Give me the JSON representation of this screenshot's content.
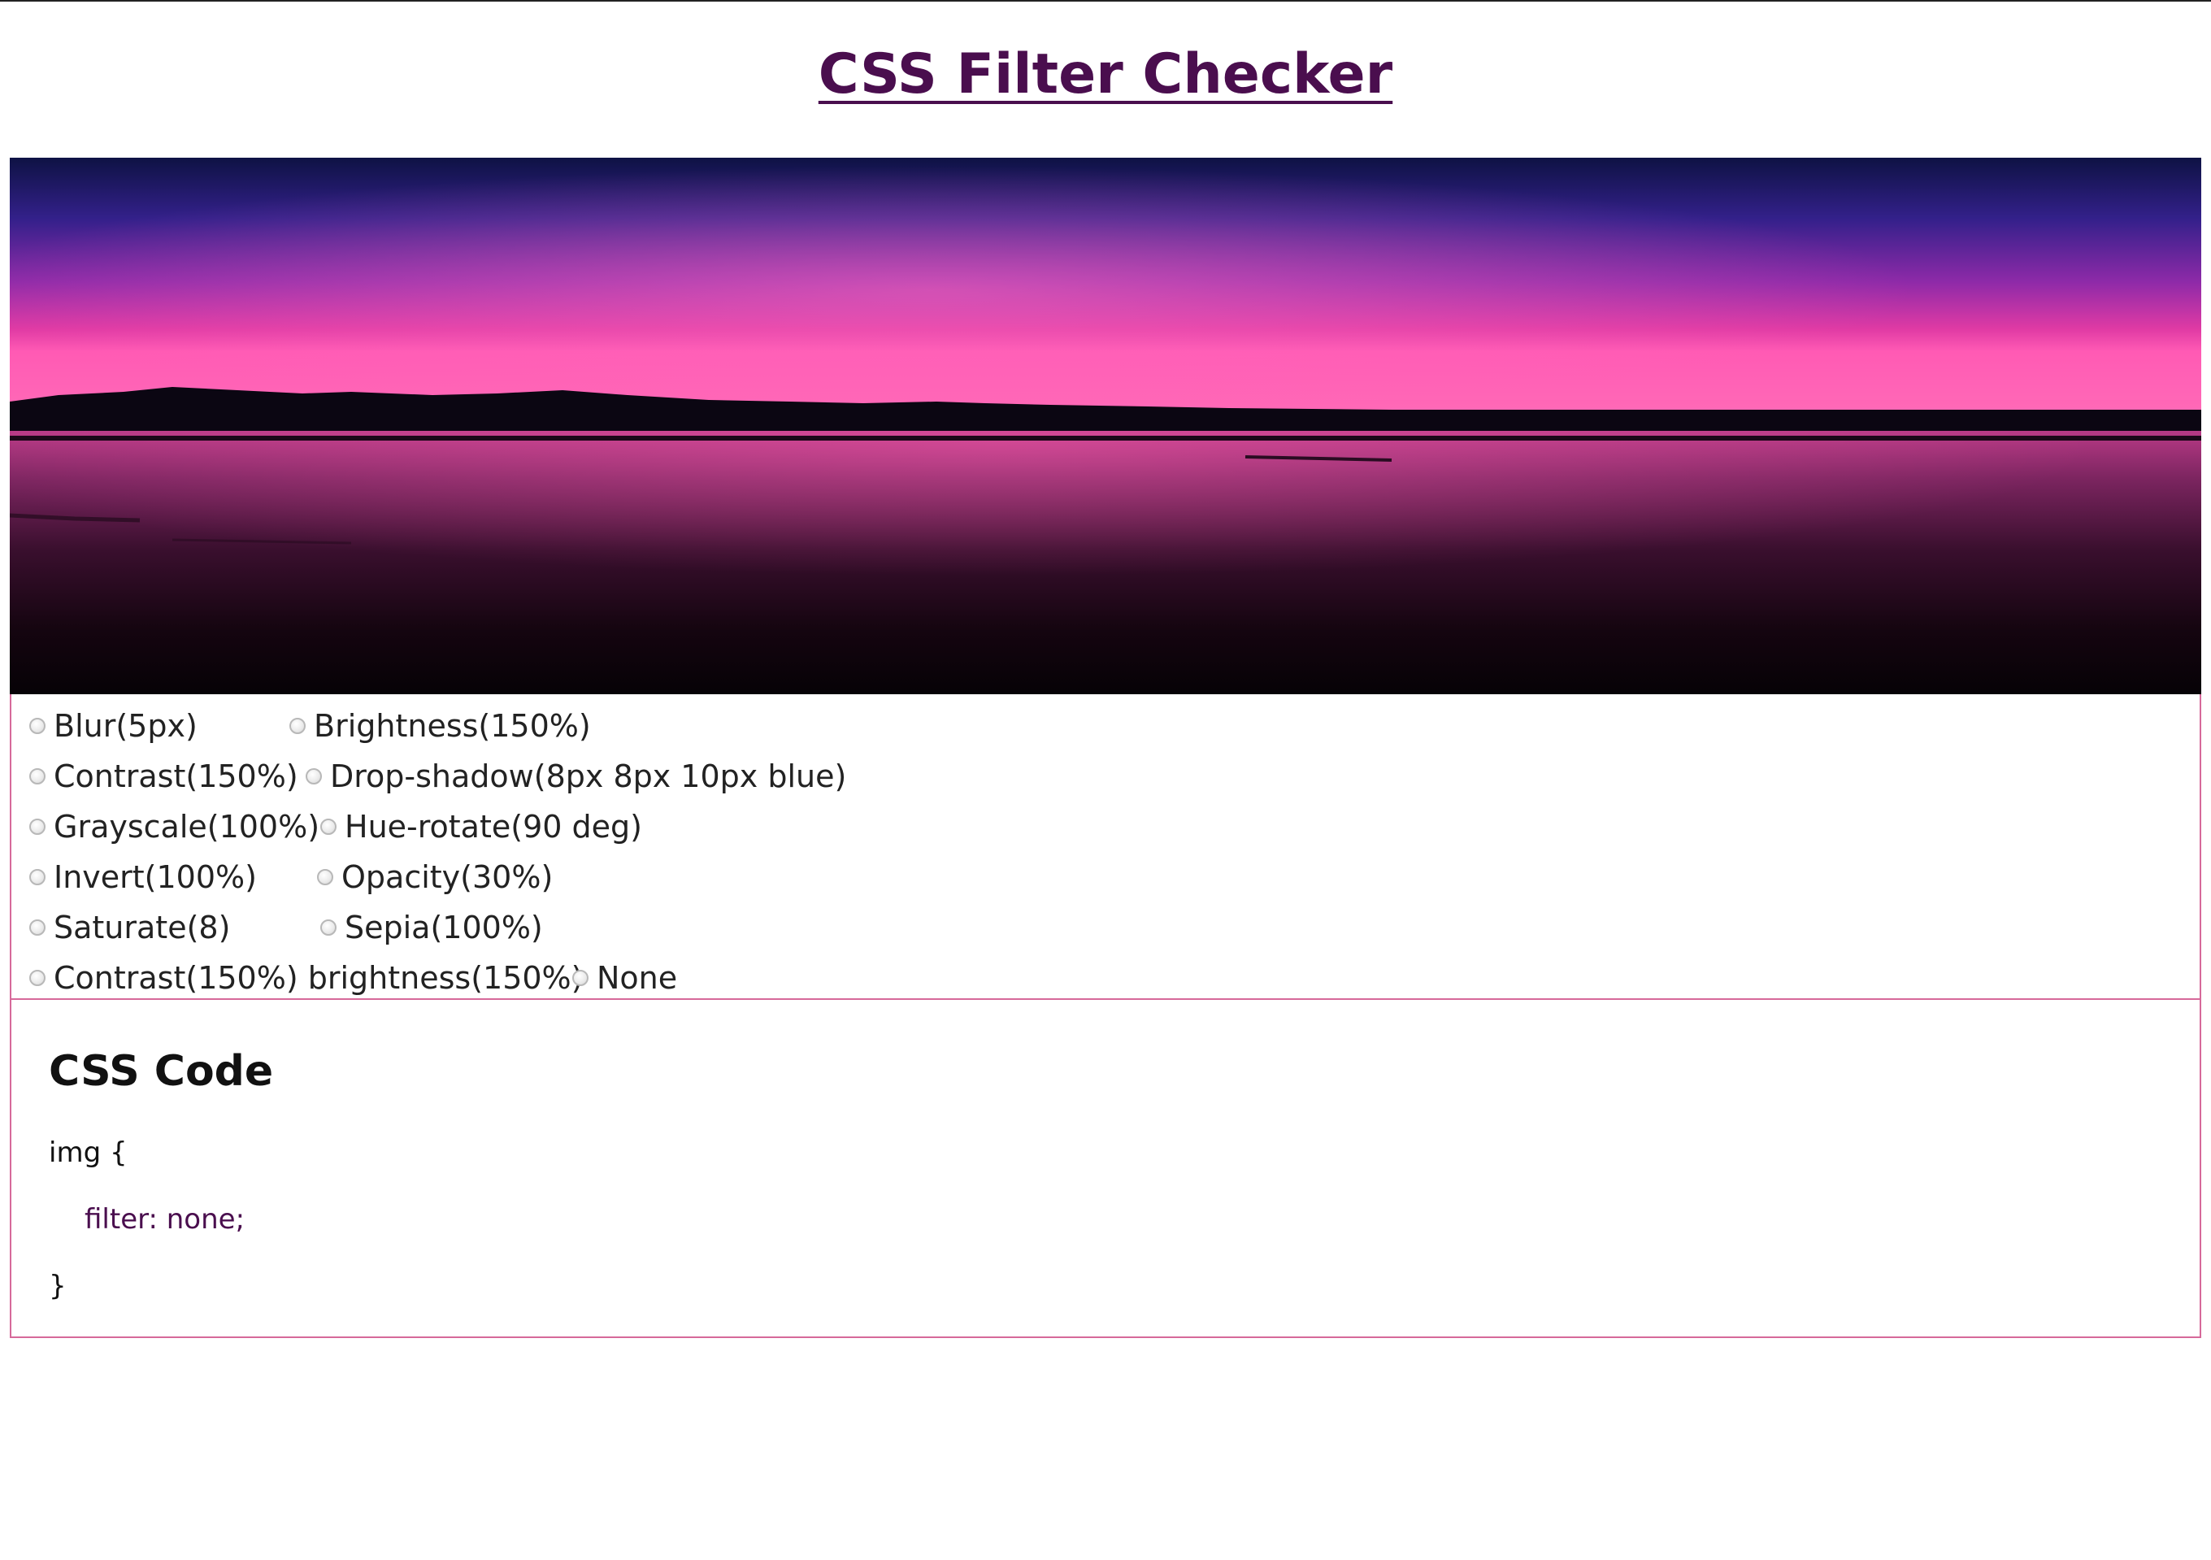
{
  "page": {
    "title": "CSS Filter Checker"
  },
  "colors": {
    "title": "#4a0e4e",
    "border": "#d6699a",
    "code_accent": "#4a0e4e"
  },
  "image": {
    "alt": "sunset over lake"
  },
  "filters": {
    "options": [
      {
        "label": "Blur(5px)"
      },
      {
        "label": "Brightness(150%)"
      },
      {
        "label": "Contrast(150%)"
      },
      {
        "label": "Drop-shadow(8px 8px 10px blue)"
      },
      {
        "label": "Grayscale(100%)"
      },
      {
        "label": "Hue-rotate(90 deg)"
      },
      {
        "label": "Invert(100%)"
      },
      {
        "label": "Opacity(30%)"
      },
      {
        "label": "Saturate(8)"
      },
      {
        "label": "Sepia(100%)"
      },
      {
        "label": "Contrast(150%) brightness(150%)"
      },
      {
        "label": "None"
      }
    ],
    "selected": "None"
  },
  "code": {
    "heading": "CSS Code",
    "open": "img {",
    "rule": "filter: none;",
    "close": "}"
  }
}
